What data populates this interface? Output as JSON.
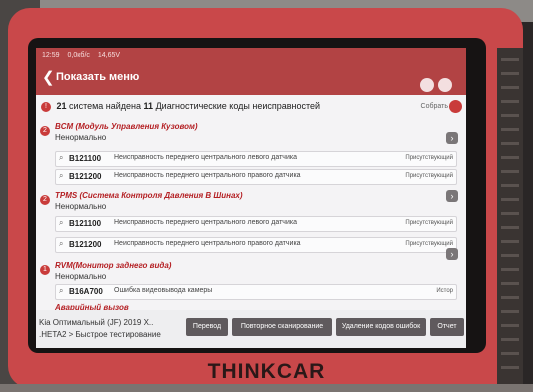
{
  "device": {
    "brand": "THINKCAR"
  },
  "status": {
    "time": "12:59",
    "speed": "0,0кб/с",
    "voltage": "14,65V"
  },
  "header": {
    "back": "❮",
    "title": "Показать меню"
  },
  "summary": {
    "count": "21",
    "text_a": "система найдена",
    "dtc_count": "11",
    "text_b": "Диагностические коды неисправностей",
    "collect": "Собрать"
  },
  "systems": [
    {
      "num": "2",
      "name": "BCM (Модуль Управления Кузовом)",
      "state": "Ненормально",
      "dtcs": [
        {
          "code": "B121100",
          "desc": "Неисправность переднего центрального левого датчика",
          "status": "Присутствующий"
        },
        {
          "code": "B121200",
          "desc": "Неисправность переднего центрального правого датчика",
          "status": "Присутствующий"
        }
      ]
    },
    {
      "num": "2",
      "name": "TPMS (Система Контроля Давления В Шинах)",
      "state": "Ненормально",
      "dtcs": [
        {
          "code": "B121100",
          "desc": "Неисправность переднего центрального левого датчика",
          "status": "Присутствующий"
        },
        {
          "code": "B121200",
          "desc": "Неисправность переднего центрального правого датчика",
          "status": "Присутствующий"
        }
      ]
    },
    {
      "num": "1",
      "name": "RVM(Монитор заднего вида)",
      "state": "Ненормально",
      "dtcs": [
        {
          "code": "B16A700",
          "desc": "Ошибка видеовывода камеры",
          "status": "Истор"
        }
      ]
    },
    {
      "name": "Аварийный вызов"
    }
  ],
  "footer": {
    "vehicle": "Kia  Оптимальный (JF) 2019  X..",
    "path": ".HETA2 > Быстрое тестирование",
    "buttons": [
      "Перевод",
      "Повторное сканирование",
      "Удаление кодов ошибок",
      "Отчет"
    ]
  },
  "colors": {
    "header": "#b24344",
    "accent": "#c93b3a",
    "button": "#5f5a5d"
  }
}
